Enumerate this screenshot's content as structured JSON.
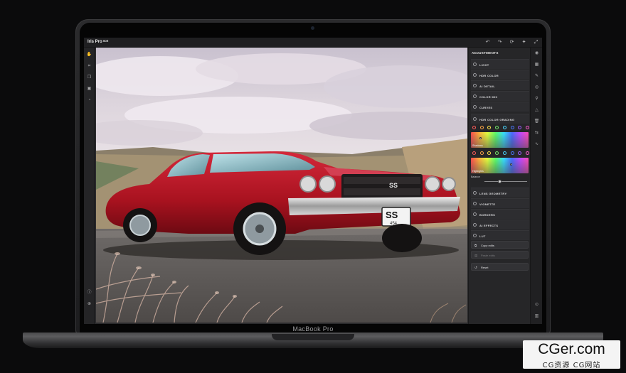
{
  "app": {
    "title": "Iris Pro",
    "title_sup": "HDR"
  },
  "device": {
    "brand": "MacBook Pro"
  },
  "toolbar": {
    "icons": [
      "hand-icon",
      "crop-icon",
      "layers-icon",
      "tag-icon",
      "history-icon",
      "info-icon",
      "zoom-icon"
    ]
  },
  "topbar": {
    "icons": [
      "undo-icon",
      "redo-icon",
      "redo-all-icon",
      "magic-wand-icon",
      "fullscreen-icon"
    ]
  },
  "panel": {
    "header": "ADJUSTMENTS",
    "sections_top": [
      "LIGHT",
      "HDR COLOR",
      "AI DETAIL",
      "COLOR MIX",
      "CURVES",
      "HDR COLOR GRADING"
    ],
    "shadows_label": "Shadows",
    "highlights_label": "Highlights",
    "balance_label": "Balance",
    "balance_value": 0.35,
    "sections_bottom": [
      "LENS GEOMETRY",
      "VIGNETTE",
      "BORDERS",
      "AI EFFECTS",
      "LUT"
    ],
    "buttons": {
      "copy": "Copy edits",
      "paste": "Paste edits",
      "reset": "Reset"
    }
  },
  "colors": {
    "swatches": [
      "#ff5a5a",
      "#ffa646",
      "#ffe24a",
      "#72e86b",
      "#4ad6ff",
      "#4a78ff",
      "#9b5cff",
      "#ff5ad0"
    ]
  },
  "photo": {
    "plate_line1": "SS",
    "plate_line2": "454"
  },
  "watermark": {
    "main": "CGer.com",
    "sub": "CG资源 CG网站"
  }
}
